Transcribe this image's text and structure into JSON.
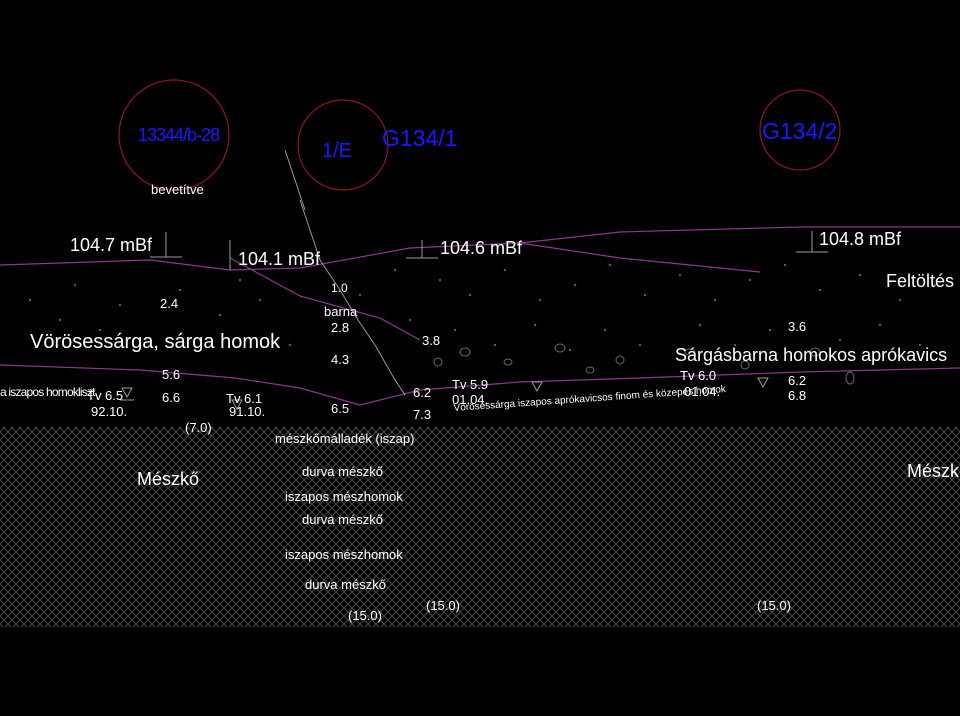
{
  "colors": {
    "background": "#000000",
    "text": "#ffffff",
    "boring_label": "#1a1aff",
    "boring_circle": "#8b1a1a",
    "section_line": "#8a3a8a",
    "hatch": "#4a4a4a",
    "dots": "#2a7a2a"
  },
  "borings": [
    {
      "id": "13344/b-28"
    },
    {
      "id": "1/E"
    },
    {
      "id": "G134/1"
    },
    {
      "id": "G134/2"
    }
  ],
  "notes": {
    "bevetitve": "bevetítve"
  },
  "elevations": {
    "e1": "104.7  mBf",
    "e2": "104.1  mBf",
    "e3": "104.6  mBf",
    "e4": "104.8  mBf"
  },
  "layers": {
    "voros_sarga": "Vörösessárga, sárga homok",
    "iszapos_homokliszt": "a iszapos homokliszt",
    "barna": "barna",
    "meszkomalladek": "mészkőmálladék (iszap)",
    "meszko_left": "Mészkő",
    "meszko_right": "Mészk",
    "durva_meszko_1": "durva mészkő",
    "iszapos_meszhomok_1": "iszapos mészhomok",
    "durva_meszko_2": "durva mészkő",
    "iszapos_meszhomok_2": "iszapos mészhomok",
    "durva_meszko_3": "durva mészkő",
    "sargasbarna": "Sárgásbarna homokos aprókavics",
    "feltoltes": "Feltöltés",
    "voros_iszapos_aprokavics": "Vörösessárga iszapos aprókavicsos finom és közepes homok"
  },
  "depths": {
    "d2_4": "2.4",
    "d5_6": "5.6",
    "d6_6": "6.6",
    "d7_0": "(7.0)",
    "d1_0": "1.0",
    "d2_8": "2.8",
    "d4_3": "4.3",
    "d6_5": "6.5",
    "d3_8": "3.8",
    "d6_2a": "6.2",
    "d7_3": "7.3",
    "d3_6": "3.6",
    "d6_2b": "6.2",
    "d6_8": "6.8",
    "d15_a": "(15.0)",
    "d15_b": "(15.0)",
    "d15_c": "(15.0)"
  },
  "water": {
    "w1_level": "Tv  6.5",
    "w1_date": "92.10.",
    "w2_level": "Tv  6.1",
    "w2_date": "91.10.",
    "w3_level": "Tv 5.9",
    "w3_date": "01.04.",
    "w4_level": "Tv 6.0",
    "w4_date": "01.04."
  }
}
